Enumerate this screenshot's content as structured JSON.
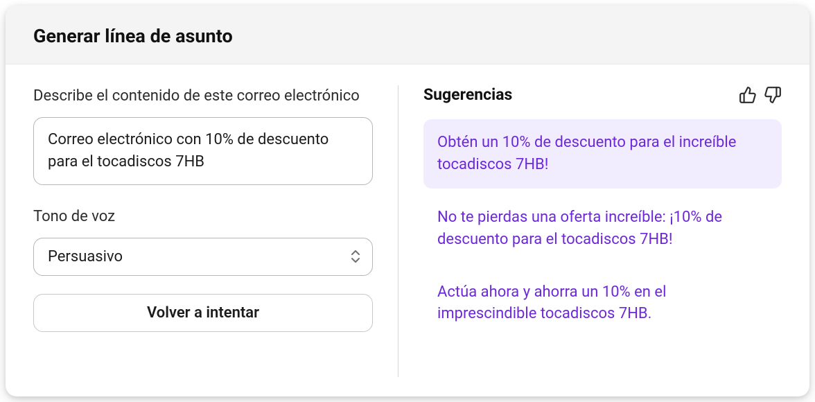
{
  "header": {
    "title": "Generar línea de asunto"
  },
  "form": {
    "description_label": "Describe el contenido de este correo electrónico",
    "description_value": "Correo electrónico con 10% de descuento para el tocadiscos 7HB",
    "tone_label": "Tono de voz",
    "tone_value": "Persuasivo",
    "retry_label": "Volver a intentar"
  },
  "suggestions": {
    "title": "Sugerencias",
    "items": [
      {
        "text": "Obtén un 10% de descuento para el increíble tocadiscos 7HB!",
        "selected": true
      },
      {
        "text": "No te pierdas una oferta increíble: ¡10% de descuento para el tocadiscos 7HB!",
        "selected": false
      },
      {
        "text": "Actúa ahora y ahorra un 10% en el imprescindible tocadiscos 7HB.",
        "selected": false
      }
    ]
  },
  "colors": {
    "accent": "#6d28d9",
    "selected_bg": "#f1edfe",
    "header_bg": "#f4f4f5"
  }
}
